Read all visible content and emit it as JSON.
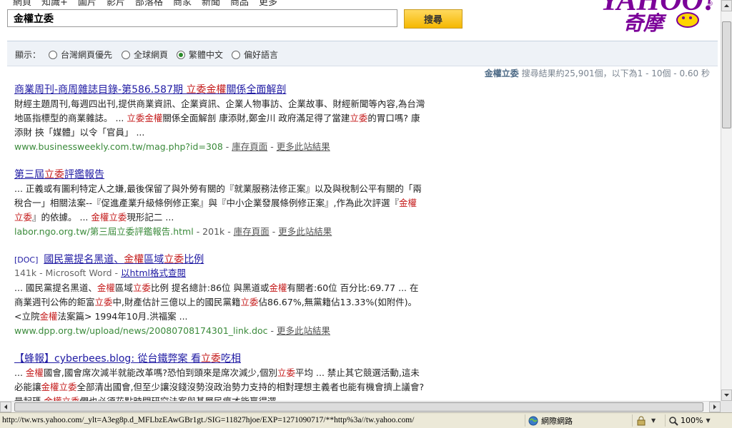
{
  "topnav": [
    "網頁",
    "知識+",
    "圖片",
    "影片",
    "部落格",
    "商家",
    "新聞",
    "商品",
    "更多"
  ],
  "search": {
    "value": "金權立委",
    "button_label": "搜尋"
  },
  "logo": {
    "text": "YAHOO!",
    "sub": "奇摩",
    "registered": "®"
  },
  "filters": {
    "label": "顯示：",
    "options": [
      {
        "label": "台灣網頁優先",
        "selected": false
      },
      {
        "label": "全球網頁",
        "selected": false
      },
      {
        "label": "繁體中文",
        "selected": true
      },
      {
        "label": "偏好語言",
        "selected": false
      }
    ]
  },
  "summary": {
    "query": "金權立委",
    "text": "搜尋結果約25,901個，以下為1 - 10個 - 0.60 秒"
  },
  "results": [
    {
      "title_parts": [
        {
          "t": "商業周刊-商周雜誌目錄-第586.587期 ",
          "hl": false
        },
        {
          "t": "立委",
          "hl": true
        },
        {
          "t": "金權",
          "hl": true
        },
        {
          "t": "關係全面解剖",
          "hl": false
        }
      ],
      "snippet_parts": [
        {
          "t": "財經主題周刊,每週四出刊,提供商業資訊、企業資訊、企業人物事訪、企業故事、財經新聞等內容,為台灣地區指標型的商業雜誌。 ... ",
          "hl": false
        },
        {
          "t": "立委",
          "hl": true
        },
        {
          "t": "金權",
          "hl": true
        },
        {
          "t": "關係全面解剖 康添財,鄭金川 政府滿足得了當建",
          "hl": false
        },
        {
          "t": "立委",
          "hl": true
        },
        {
          "t": "的胃口嗎? 康添財 挾「媒體」以令「官員」 ...",
          "hl": false
        }
      ],
      "url": "www.businessweekly.com.tw/mag.php?id=308",
      "size": "",
      "cache": "庫存頁面",
      "more": "更多此站結果"
    },
    {
      "title_parts": [
        {
          "t": "第三屆",
          "hl": false
        },
        {
          "t": "立委",
          "hl": true
        },
        {
          "t": "評鑑報告",
          "hl": false
        }
      ],
      "snippet_parts": [
        {
          "t": "... 正義或有圖利特定人之嫌,最後保留了與外勞有關的『就業服務法修正案』以及與稅制公平有關的「兩稅合一」相關法案--『促進產業升級條例修正案』與『中小企業發展條例修正案』,作為此次評選『",
          "hl": false
        },
        {
          "t": "金權立委",
          "hl": true
        },
        {
          "t": "』的依據。 ... ",
          "hl": false
        },
        {
          "t": "金權立委",
          "hl": true
        },
        {
          "t": "現形記二 ...",
          "hl": false
        }
      ],
      "url": "labor.ngo.org.tw/第三屆立委評鑑報告.html",
      "size": "201k",
      "cache": "庫存頁面",
      "more": "更多此站結果"
    },
    {
      "doc_tag": "[DOC]",
      "title_parts": [
        {
          "t": "國民黨提名黑道、",
          "hl": false
        },
        {
          "t": "金權",
          "hl": true
        },
        {
          "t": "區域",
          "hl": false
        },
        {
          "t": "立委",
          "hl": true
        },
        {
          "t": "比例",
          "hl": false
        }
      ],
      "meta": "141k - Microsoft Word - ",
      "meta_link": "以html格式查閱",
      "snippet_parts": [
        {
          "t": "... 國民黨提名黑道、",
          "hl": false
        },
        {
          "t": "金權",
          "hl": true
        },
        {
          "t": "區域",
          "hl": false
        },
        {
          "t": "立委",
          "hl": true
        },
        {
          "t": "比例 提名總計:86位 與黑道或",
          "hl": false
        },
        {
          "t": "金權",
          "hl": true
        },
        {
          "t": "有關者:60位 百分比:69.77 ... 在商業週刊公佈的鉅富",
          "hl": false
        },
        {
          "t": "立委",
          "hl": true
        },
        {
          "t": "中,財產估計三億以上的國民黨籍",
          "hl": false
        },
        {
          "t": "立委",
          "hl": true
        },
        {
          "t": "佔86.67%,無黨籍佔13.33%(如附件)。 <立院",
          "hl": false
        },
        {
          "t": "金權",
          "hl": true
        },
        {
          "t": "法案篇> 1994年10月.洪福案 ...",
          "hl": false
        }
      ],
      "url": "www.dpp.org.tw/upload/news/20080708174301_link.doc",
      "size": "",
      "cache": "",
      "more": "更多此站結果"
    },
    {
      "title_parts": [
        {
          "t": "【蜂報】cyberbees.blog: 從台鐵弊案 看",
          "hl": false
        },
        {
          "t": "立委",
          "hl": true
        },
        {
          "t": "吃相",
          "hl": false
        }
      ],
      "snippet_parts": [
        {
          "t": "... ",
          "hl": false
        },
        {
          "t": "金權",
          "hl": true
        },
        {
          "t": "國會,國會席次減半就能改革嗎?恐怕到頭來是席次減少,個別",
          "hl": false
        },
        {
          "t": "立委",
          "hl": true
        },
        {
          "t": "平均 ... 禁止其它競選活動,這未必能讓",
          "hl": false
        },
        {
          "t": "金權立委",
          "hl": true
        },
        {
          "t": "全部清出國會,但至少讓沒錢沒勢沒政治勢力支持的相對理想主義者也能有機會擠上議會?最起碼 ",
          "hl": false
        },
        {
          "t": "金權立委",
          "hl": true
        },
        {
          "t": "們也必須花點時間研究法案與基層民瘼才能贏得選 ...",
          "hl": false
        }
      ],
      "url": "",
      "size": "",
      "cache": "",
      "more": ""
    }
  ],
  "statusbar": {
    "url": "http://tw.wrs.yahoo.com/_ylt=A3eg8p.d_MFLbzEAwGBr1gt./SIG=11827hjoe/EXP=1271090717/**http%3a//tw.yahoo.com/",
    "zone": "網際網路",
    "zoom": "100%"
  }
}
